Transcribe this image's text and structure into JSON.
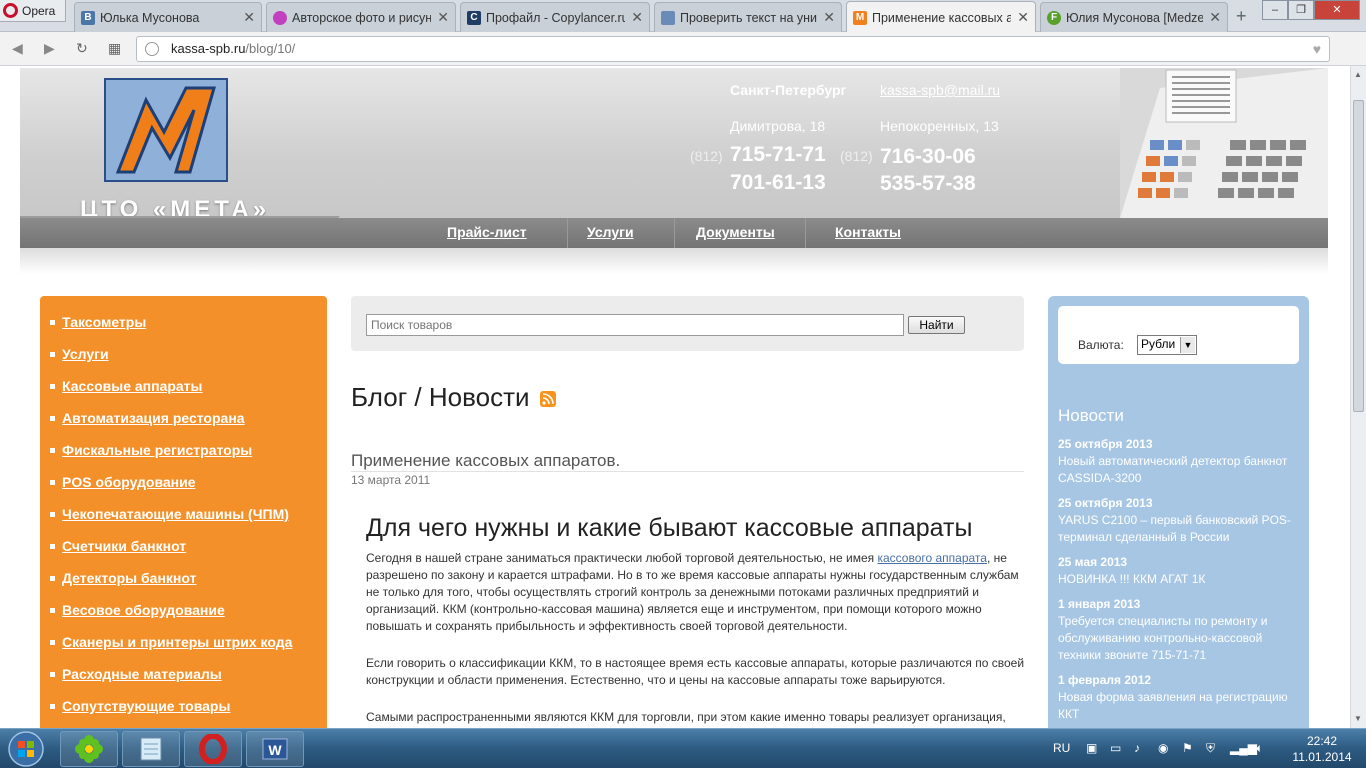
{
  "browser": {
    "menu_label": "Opera",
    "tabs": [
      {
        "title": "Юлька Мусонова",
        "favicon": "vk-icon",
        "color": "#4a76a8"
      },
      {
        "title": "Авторское фото и рисун",
        "favicon": "smiley-icon",
        "color": "#c040c0"
      },
      {
        "title": "Профайл - Copylancer.ru",
        "favicon": "copylancer-icon",
        "color": "#1e3c64"
      },
      {
        "title": "Проверить текст на уник",
        "favicon": "shield-icon",
        "color": "#6a8ab8"
      },
      {
        "title": "Применение кассовых ап",
        "favicon": "meta-icon",
        "color": "#f08020",
        "active": true
      },
      {
        "title": "Юлия Мусонова [Medzer",
        "favicon": "f-icon",
        "color": "#5aa02c"
      }
    ],
    "url_host": "kassa-spb.ru",
    "url_path": "/blog/10/"
  },
  "header": {
    "logo_text": "ЦТО «МЕТА»",
    "city": "Санкт-Петербург",
    "email": "kassa-spb@mail.ru",
    "address1": "Димитрова, 18",
    "address2": "Непокоренных, 13",
    "code": "(812)",
    "phone1a": "715-71-71",
    "phone1b": "701-61-13",
    "phone2a": "716-30-06",
    "phone2b": "535-57-38"
  },
  "topmenu": [
    {
      "label": "Прайс-лист"
    },
    {
      "label": "Услуги"
    },
    {
      "label": "Документы"
    },
    {
      "label": "Контакты"
    }
  ],
  "categories": [
    "Таксометры",
    "Услуги",
    "Кассовые аппараты",
    "Автоматизация ресторана",
    "Фискальные регистраторы",
    "POS оборудование",
    "Чекопечатающие машины (ЧПМ)",
    "Счетчики банкнот",
    "Детекторы банкнот",
    "Весовое оборудование",
    "Сканеры и принтеры штрих кода",
    "Расходные материалы",
    "Сопутствующие товары"
  ],
  "search": {
    "placeholder": "Поиск товаров",
    "button": "Найти"
  },
  "blog": {
    "title": "Блог / Новости",
    "post_title": "Применение кассовых аппаратов.",
    "post_date": "13 марта 2011",
    "article_heading": "Для чего нужны и какие бывают кассовые аппараты",
    "p1_before": "Сегодня в нашей стране заниматься практически любой торговой деятельностью, не имея ",
    "p1_link": "кассового аппарата",
    "p1_after": ", не разрешено по закону и карается штрафами. Но в то же время кассовые аппараты нужны государственным службам не только для того, чтобы осуществлять строгий контроль за денежными потоками различных предприятий и организаций. ККМ (контрольно-кассовая машина) является еще и инструментом, при помощи которого можно повышать и сохранять прибыльность и эффективность своей торговой деятельности.",
    "p2": "Если говорить о классификации ККМ, то в настоящее время есть кассовые аппараты, которые различаются по своей конструкции и области применения. Естественно, что и цены на кассовые аппараты тоже варьируются.",
    "p3": "Самыми распространенными являются ККМ для торговли, при этом какие именно товары реализует организация,"
  },
  "sidebar": {
    "currency_label": "Валюта:",
    "currency_value": "Рубли",
    "news_heading": "Новости",
    "news": [
      {
        "date": "25 октября 2013",
        "text": "Новый автоматический детектор банкнот CASSIDA-3200"
      },
      {
        "date": "25 октября 2013",
        "text": "YARUS C2100 – первый банковский POS-терминал сделанный в России"
      },
      {
        "date": "25 мая 2013",
        "text": "НОВИНКА !!! ККМ АГАТ 1К"
      },
      {
        "date": "1 января 2013",
        "text": "Требуется специалисты по ремонту и обслуживанию контрольно-кассовой техники звоните 715-71-71"
      },
      {
        "date": "1 февраля 2012",
        "text": "Новая форма заявления на регистрацию ККТ"
      }
    ]
  },
  "taskbar": {
    "lang": "RU",
    "time": "22:42",
    "date": "11.01.2014"
  }
}
